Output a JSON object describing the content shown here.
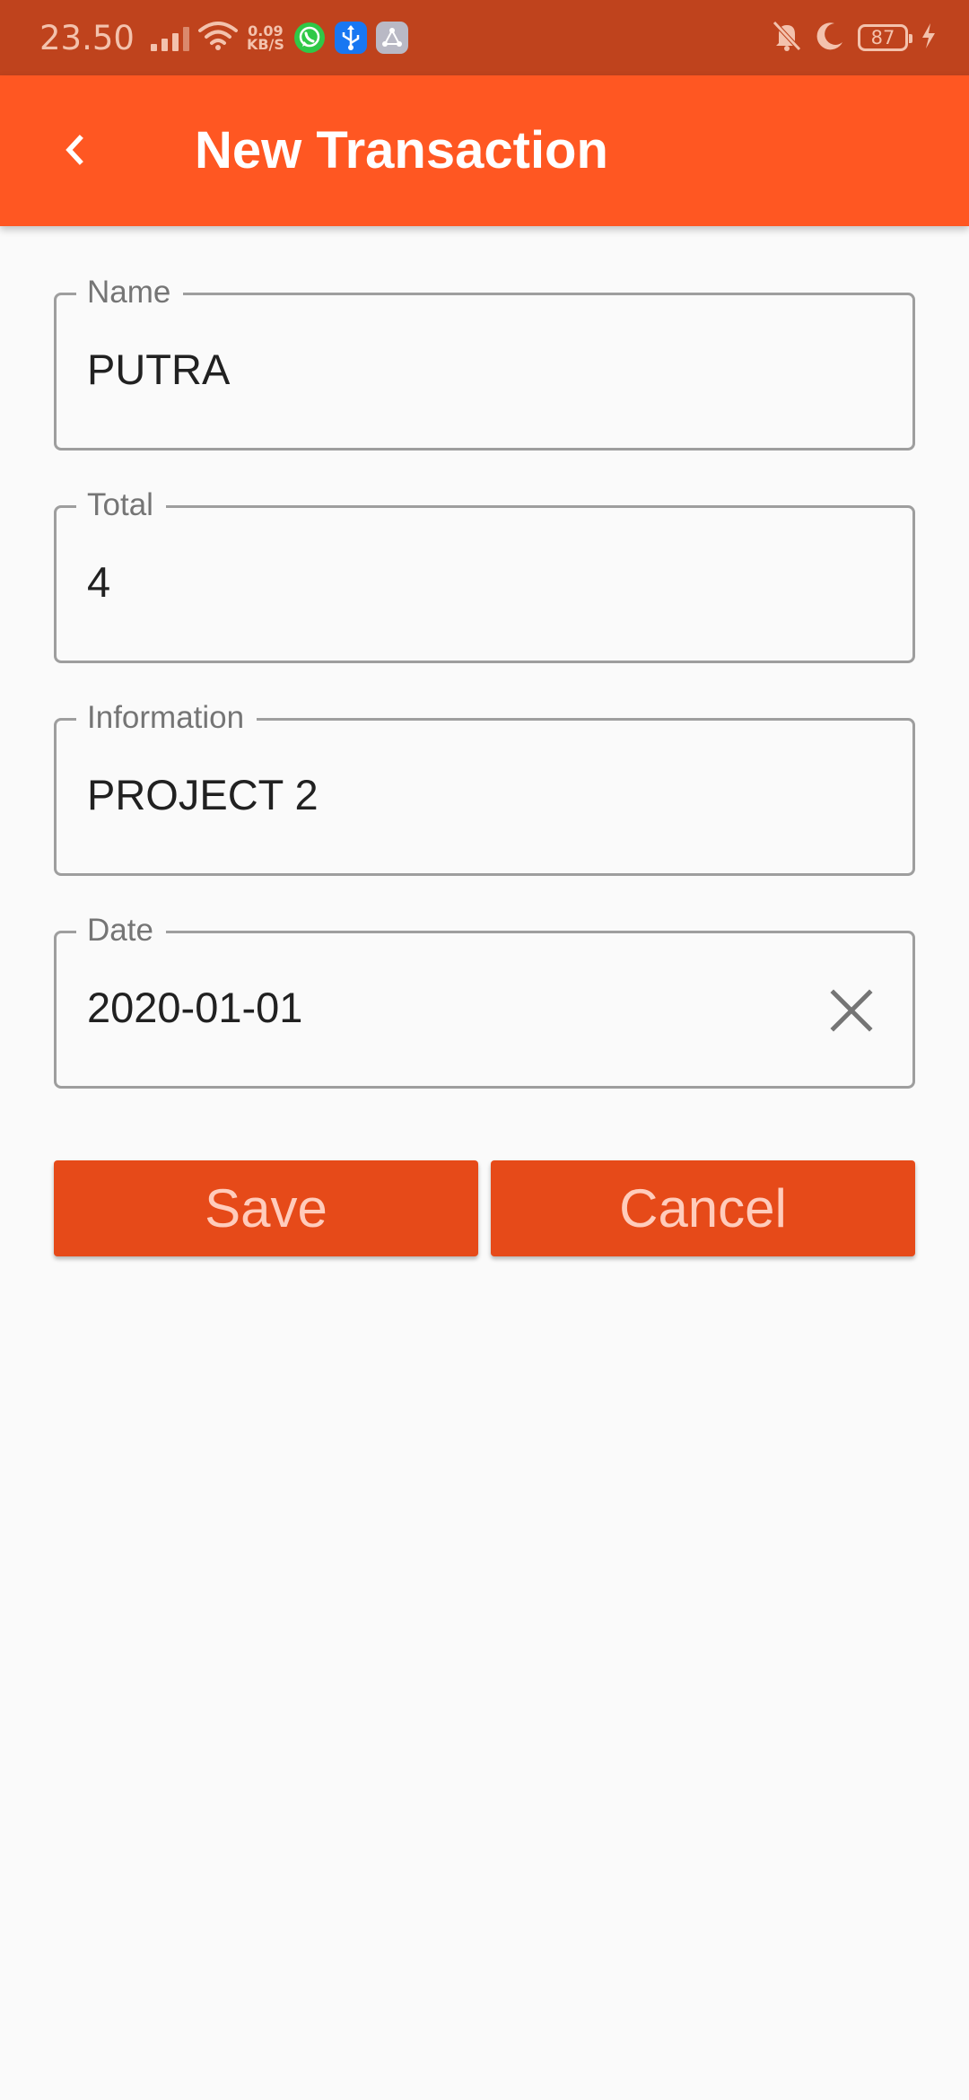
{
  "status_bar": {
    "time": "23.50",
    "speed_value": "0.09",
    "speed_unit": "KB/S",
    "battery": "87",
    "icons": [
      "signal-icon",
      "wifi-icon",
      "whatsapp-icon",
      "usb-icon",
      "app-icon",
      "mute-icon",
      "moon-icon",
      "battery-icon",
      "charging-icon"
    ]
  },
  "app_bar": {
    "title": "New Transaction",
    "back_icon": "chevron-left-icon"
  },
  "form": {
    "name": {
      "label": "Name",
      "value": "PUTRA"
    },
    "total": {
      "label": "Total",
      "value": "4"
    },
    "information": {
      "label": "Information",
      "value": "PROJECT 2"
    },
    "date": {
      "label": "Date",
      "value": "2020-01-01",
      "clear_icon": "close-icon"
    }
  },
  "actions": {
    "save_label": "Save",
    "cancel_label": "Cancel"
  },
  "colors": {
    "status_bar": "#bf431d",
    "app_bar": "#ff5722",
    "button": "#e64a19",
    "button_text": "#ffccbc",
    "background": "#fafafa",
    "field_border": "#9e9e9e"
  }
}
